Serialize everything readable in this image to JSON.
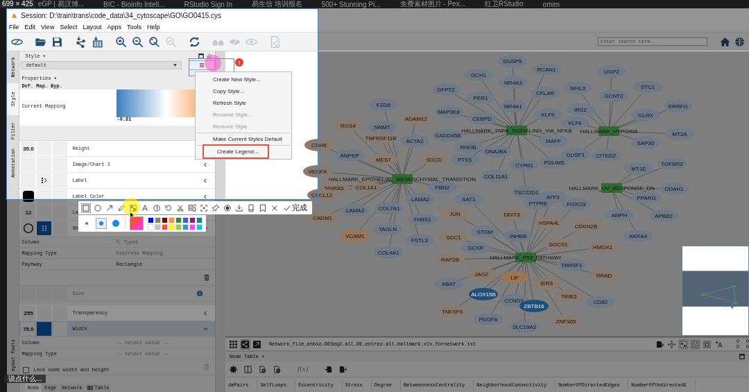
{
  "capture_size": "699 × 425",
  "browser_tabs": [
    "eGP | 易汉博...",
    "BIC - Bioinfo Intell...",
    "RStudio Sign In",
    "易生信 培训报名",
    "500+ Stunning Pi...",
    "免费素材图片 - Pex...",
    "红卫RStudio",
    "omim"
  ],
  "window": {
    "title": "Session: D:\\train\\trans\\code_data\\34_cytoscape\\GO\\GO0415.cys"
  },
  "menu": [
    "File",
    "Edit",
    "View",
    "Select",
    "Layout",
    "Apps",
    "Tools",
    "Help"
  ],
  "toolbar": [
    {
      "kind": "logo",
      "disabled": false
    },
    {
      "kind": "open",
      "disabled": false
    },
    {
      "kind": "save",
      "disabled": false
    },
    {
      "kind": "import-network",
      "disabled": false
    },
    {
      "kind": "import-table",
      "disabled": false
    },
    {
      "kind": "zoom-in",
      "disabled": false
    },
    {
      "kind": "zoom-out",
      "disabled": false
    },
    {
      "kind": "zoom-fit",
      "disabled": false
    },
    {
      "kind": "zoom-selected",
      "disabled": true
    },
    {
      "kind": "refresh",
      "disabled": false
    },
    {
      "kind": "neighbors",
      "disabled": true
    },
    {
      "kind": "hide",
      "disabled": true
    },
    {
      "kind": "show",
      "disabled": true
    },
    {
      "kind": "export",
      "disabled": true
    }
  ],
  "search": {
    "placeholder": "Enter search term..."
  },
  "side_tabs": [
    {
      "label": "Network",
      "selected": false
    },
    {
      "label": "Style",
      "selected": true
    },
    {
      "label": "Filter",
      "selected": false
    },
    {
      "label": "Annotation",
      "selected": false
    }
  ],
  "side_tools_label": "ayout Tools",
  "style_panel": {
    "header": "Style ▾",
    "style_name": "default",
    "properties_header": "Properties ▾",
    "column_heads": [
      "Def.",
      "Map.",
      "Byp."
    ],
    "current_mapping": {
      "label": "Current Mapping",
      "min_label": "-0.81"
    },
    "properties": [
      {
        "name": "Height",
        "default": {
          "kind": "text",
          "text": "35.0"
        },
        "selected": false,
        "disabled": false
      },
      {
        "name": "Image/Chart 1",
        "arrow": true,
        "expanded": false,
        "selected": false,
        "disabled": false
      },
      {
        "name": "Label",
        "mapping": {
          "kind": "passthrough"
        },
        "arrow": true,
        "expanded": false,
        "selected": false,
        "disabled": false
      },
      {
        "name": "Label Color",
        "default": {
          "kind": "color",
          "color": "#000000"
        },
        "arrow": true,
        "expanded": false,
        "selected": false,
        "disabled": false
      },
      {
        "name": "La",
        "default": {
          "kind": "text",
          "text": "12"
        },
        "selected": false,
        "disabled": false
      },
      {
        "name": "Sh",
        "default": {
          "kind": "shape"
        },
        "mapping": {
          "kind": "discrete"
        },
        "expanded": true,
        "selected": false,
        "disabled": false,
        "delete_disabled": false,
        "details": [
          {
            "label": "Column",
            "value": "Type1",
            "icon": true,
            "disabled": true
          },
          {
            "label": "Mapping Type",
            "value": "Discrete Mapping",
            "icon": false,
            "disabled": true
          },
          {
            "label": "Payhway",
            "value": "Rectangle",
            "icon": false,
            "disabled": false
          }
        ]
      },
      {
        "name": "Size",
        "info": true,
        "expanded": false,
        "selected": false,
        "disabled": true
      },
      {
        "name": "Transparency",
        "default": {
          "kind": "text",
          "text": "255"
        },
        "arrow": true,
        "expanded": false,
        "selected": false,
        "disabled": false
      },
      {
        "name": "Width",
        "default": {
          "kind": "text",
          "text": "75.0"
        },
        "mapping": {
          "kind": "continuous"
        },
        "expanded": true,
        "selected": true,
        "disabled": false,
        "delete_disabled": true,
        "details": [
          {
            "label": "Column",
            "value": "-- select value --",
            "icon": false,
            "disabled": true
          },
          {
            "label": "Mapping Type",
            "value": "-- select value --",
            "icon": false,
            "disabled": true
          }
        ]
      }
    ],
    "lock": {
      "label": "Lock node width and height",
      "checked": false
    },
    "bottom_tabs": [
      {
        "label": "Node",
        "selected": true,
        "icon": false
      },
      {
        "label": "Edge",
        "selected": false,
        "icon": false
      },
      {
        "label": "Network",
        "selected": false,
        "icon": false
      },
      {
        "label": "Table",
        "selected": false,
        "icon": true
      }
    ]
  },
  "style_menu": {
    "badge": "1",
    "items": [
      {
        "kind": "item",
        "label": "Create New Style...",
        "disabled": false,
        "annotated": false
      },
      {
        "kind": "item",
        "label": "Copy Style...",
        "disabled": false,
        "annotated": false
      },
      {
        "kind": "item",
        "label": "Refresh Style",
        "disabled": false,
        "annotated": false
      },
      {
        "kind": "item",
        "label": "Rename Style...",
        "disabled": true,
        "annotated": false
      },
      {
        "kind": "item",
        "label": "Remove Style",
        "disabled": true,
        "annotated": false
      },
      {
        "kind": "separator"
      },
      {
        "kind": "item",
        "label": "Make Current Styles Default",
        "disabled": false,
        "annotated": false
      },
      {
        "kind": "separator"
      },
      {
        "kind": "item",
        "label": "Create Legend...",
        "disabled": false,
        "annotated": true
      }
    ]
  },
  "hubs": [
    {
      "label": "HALLMARK_EPITHELIAL_MESENCHYMAL_TRANSITION",
      "genes": [
        {
          "label": "FZD8",
          "color": "#6e7a88"
        },
        {
          "label": "ADAM12",
          "color": "#8a7a6e"
        },
        {
          "label": "RGS4",
          "color": "#8a7a6e"
        },
        {
          "label": "NNMT",
          "color": "#6e7a88"
        },
        {
          "label": "TNFRSF11B",
          "color": "#8a7a6e"
        },
        {
          "label": "CDH6",
          "color": "#8a7a6e"
        },
        {
          "label": "ACTA2",
          "color": "#6e7a88"
        },
        {
          "label": "ANPEP",
          "color": "#6e7a88"
        },
        {
          "label": "MEST",
          "color": "#8a7a6e"
        },
        {
          "label": "SGCD",
          "color": "#8a7a6e"
        },
        {
          "label": "VEGFA",
          "color": "#8a7a6e"
        },
        {
          "label": "MXRA5",
          "color": "#8a7a6e"
        },
        {
          "label": "COL1A1",
          "color": "#8a7a6e"
        },
        {
          "label": "FBN2",
          "color": "#6e7a88"
        },
        {
          "label": "CXCL12",
          "color": "#8a7a6e"
        },
        {
          "label": "LAMA2",
          "color": "#6e7a88"
        },
        {
          "label": "LAMA3",
          "color": "#6e7a88"
        },
        {
          "label": "COL7A1",
          "color": "#6e7a88"
        },
        {
          "label": "CADM1",
          "color": "#8a7a6e"
        },
        {
          "label": "THBS1",
          "color": "#6e7a88"
        },
        {
          "label": "TAGLN",
          "color": "#6e7a88"
        },
        {
          "label": "VCAM1",
          "color": "#9a7558"
        },
        {
          "label": "FSTL3",
          "color": "#6e7a88"
        },
        {
          "label": "COL4A1",
          "color": "#6e7a88"
        }
      ]
    },
    {
      "label": "HALLMARK_TNFA_SIGNALING_VIA_NFKB",
      "genes": [
        {
          "label": "DUSP5",
          "color": "#6e7a88"
        },
        {
          "label": "RCAN1",
          "color": "#6e7a88"
        },
        {
          "label": "GCH1",
          "color": "#6e7a88"
        },
        {
          "label": "NR4A3",
          "color": "#6e7a88"
        },
        {
          "label": "GFPT2",
          "color": "#6e7a88"
        },
        {
          "label": "PER1",
          "color": "#6e7a88"
        },
        {
          "label": "CFLAR",
          "color": "#6e7a88"
        },
        {
          "label": "NR4A1",
          "color": "#6e7a88"
        },
        {
          "label": "MAP3K8",
          "color": "#6e7a88"
        },
        {
          "label": "KLF9",
          "color": "#6e7a88"
        },
        {
          "label": "CEBPD",
          "color": "#6e7a88"
        },
        {
          "label": "GADD45B",
          "color": "#6e7a88"
        },
        {
          "label": "MAFF",
          "color": "#6e7a88"
        },
        {
          "label": "RHOB",
          "color": "#6e7a88"
        },
        {
          "label": "DNAJB4",
          "color": "#6e7a88"
        },
        {
          "label": "PTX3",
          "color": "#6e7a88"
        },
        {
          "label": "CYR61",
          "color": "#6e7a88"
        },
        {
          "label": "PDLIM5",
          "color": "#6e7a88"
        },
        {
          "label": "COL11A1",
          "color": "#6e7a88"
        },
        {
          "label": "TSC22D1",
          "color": "#6e7a88"
        }
      ]
    },
    {
      "label": "HALLMARK_HYPOXIA",
      "genes": [
        {
          "label": "UGP2",
          "color": "#6e7a88"
        },
        {
          "label": "NFIL3",
          "color": "#6e7a88"
        },
        {
          "label": "STC1",
          "color": "#6e7a88"
        },
        {
          "label": "GCNT2",
          "color": "#6e7a88"
        },
        {
          "label": "ERRFI1",
          "color": "#6e7a88"
        },
        {
          "label": "IRS2",
          "color": "#6e7a88"
        },
        {
          "label": "GLRX",
          "color": "#6e7a88"
        },
        {
          "label": "KLF6",
          "color": "#6e7a88"
        },
        {
          "label": "MT2A",
          "color": "#6e7a88"
        },
        {
          "label": "SAP30",
          "color": "#6e7a88"
        },
        {
          "label": "DUSP1",
          "color": "#6e7a88"
        },
        {
          "label": "CITED2",
          "color": "#6e7a88"
        }
      ]
    },
    {
      "label": "HALLMARK_UV_RESPONSE_DN",
      "genes": [
        {
          "label": "MT1E",
          "color": "#6e7a88"
        },
        {
          "label": "TGFBR2",
          "color": "#6e7a88"
        },
        {
          "label": "DDAH1",
          "color": "#6e7a88"
        },
        {
          "label": "PPARG",
          "color": "#6e7a88"
        },
        {
          "label": "APBB2",
          "color": "#6e7a88"
        },
        {
          "label": "AMPH",
          "color": "#6e7a88"
        },
        {
          "label": "ANXA4",
          "color": "#6e7a88"
        }
      ]
    },
    {
      "label": "HALLMARK_P53_PATHWAY",
      "genes": [
        {
          "label": "ATF3",
          "color": "#6e7a88"
        },
        {
          "label": "PTPRE",
          "color": "#6e7a88"
        },
        {
          "label": "FOXO3",
          "color": "#6e7a88"
        },
        {
          "label": "SAT1",
          "color": "#6e7a88"
        },
        {
          "label": "JUN",
          "color": "#8a7a6e"
        },
        {
          "label": "DDIT3",
          "color": "#8a7a6e"
        },
        {
          "label": "HSPA4L",
          "color": "#8a7a6e"
        },
        {
          "label": "CDKN2B",
          "color": "#8a7a6e"
        },
        {
          "label": "STOM",
          "color": "#6e7a88"
        },
        {
          "label": "INHBB",
          "color": "#6e7a88"
        },
        {
          "label": "SDC1",
          "color": "#8a7a6e"
        },
        {
          "label": "SOCS1",
          "color": "#8a7a6e"
        },
        {
          "label": "HMOX1",
          "color": "#8a7a6e"
        },
        {
          "label": "DCXR",
          "color": "#6e7a88"
        },
        {
          "label": "RAP2B",
          "color": "#8a7a6e"
        },
        {
          "label": "TM4SF1",
          "color": "#6e7a88"
        },
        {
          "label": "RRAD",
          "color": "#8a7a6e"
        },
        {
          "label": "JAG2",
          "color": "#8a7a6e"
        },
        {
          "label": "LIF",
          "color": "#9a7558"
        },
        {
          "label": "ABAT",
          "color": "#6e7a88"
        },
        {
          "label": "IER3",
          "color": "#8a7a6e"
        },
        {
          "label": "ALOX15B",
          "color": "#1f4f78"
        },
        {
          "label": "TRIB3",
          "color": "#8a7a6e"
        },
        {
          "label": "CCND3",
          "color": "#6e7a88"
        },
        {
          "label": "ZBTB16",
          "color": "#1f4f78"
        },
        {
          "label": "CD82",
          "color": "#6e7a88"
        },
        {
          "label": "TNFSF9",
          "color": "#8a7a6e"
        },
        {
          "label": "PDGFA",
          "color": "#6e7a88"
        },
        {
          "label": "ZNF365",
          "color": "#8a7a6e"
        },
        {
          "label": "SLC19A2",
          "color": "#6e7a88"
        }
      ]
    }
  ],
  "network_bar": {
    "file_name": "Network_file_ehbio.DESeq2.all.DE.entrez.all.Hallmark.xls.fornetwork.txt",
    "counts": [
      "0",
      "0",
      "0",
      "0"
    ]
  },
  "table_panel": {
    "title": "Node Table ▾",
    "function_label": "f(x)",
    "columns": [
      "dePairs",
      "SelfLoops",
      "Eccentricity",
      "Stress",
      "Degree",
      "BetweennessCentrality",
      "NeighborhoodConnectivity",
      "NumberOfDirectedEdges",
      "NumberOfUndirectedE"
    ]
  },
  "annotation_toolbar": {
    "tools": [
      {
        "kind": "rectangle",
        "selected": true
      },
      {
        "kind": "ellipse",
        "selected": false
      },
      {
        "kind": "arrow",
        "selected": false
      },
      {
        "kind": "pencil",
        "selected": false
      },
      {
        "kind": "mosaic",
        "selected": false
      },
      {
        "kind": "text",
        "selected": false
      },
      {
        "kind": "number",
        "selected": false
      },
      {
        "kind": "undo",
        "selected": false
      },
      {
        "kind": "scissors",
        "selected": false
      },
      {
        "kind": "translate",
        "selected": false
      },
      {
        "kind": "crop",
        "selected": false
      },
      {
        "kind": "pin",
        "selected": false
      },
      {
        "kind": "record",
        "selected": false
      },
      {
        "kind": "download",
        "selected": false
      },
      {
        "kind": "phone",
        "selected": false
      },
      {
        "kind": "bookmark",
        "selected": false
      },
      {
        "kind": "close",
        "selected": false
      }
    ],
    "done": "完成",
    "brush_sizes": [
      {
        "selected": false
      },
      {
        "selected": true
      },
      {
        "selected": false
      }
    ],
    "palette": [
      {
        "color": "#0000ff"
      },
      {
        "color": "#808080"
      },
      {
        "color": "#800000"
      },
      {
        "color": "#f7943b"
      },
      {
        "color": "#2e8b37"
      },
      {
        "color": "#3a5fcd"
      },
      {
        "color": "#8b1a8b"
      },
      {
        "color": "#008b8b"
      },
      {
        "color": "#ffffff"
      },
      {
        "color": "#c0c0c0"
      },
      {
        "color": "#ff4b3a"
      },
      {
        "color": "#ffff00"
      },
      {
        "color": "#9acd32"
      },
      {
        "color": "#3a8ee6"
      },
      {
        "color": "#ff3cff"
      },
      {
        "color": "#00ced1"
      }
    ]
  },
  "chat_hint": "说点什么..."
}
